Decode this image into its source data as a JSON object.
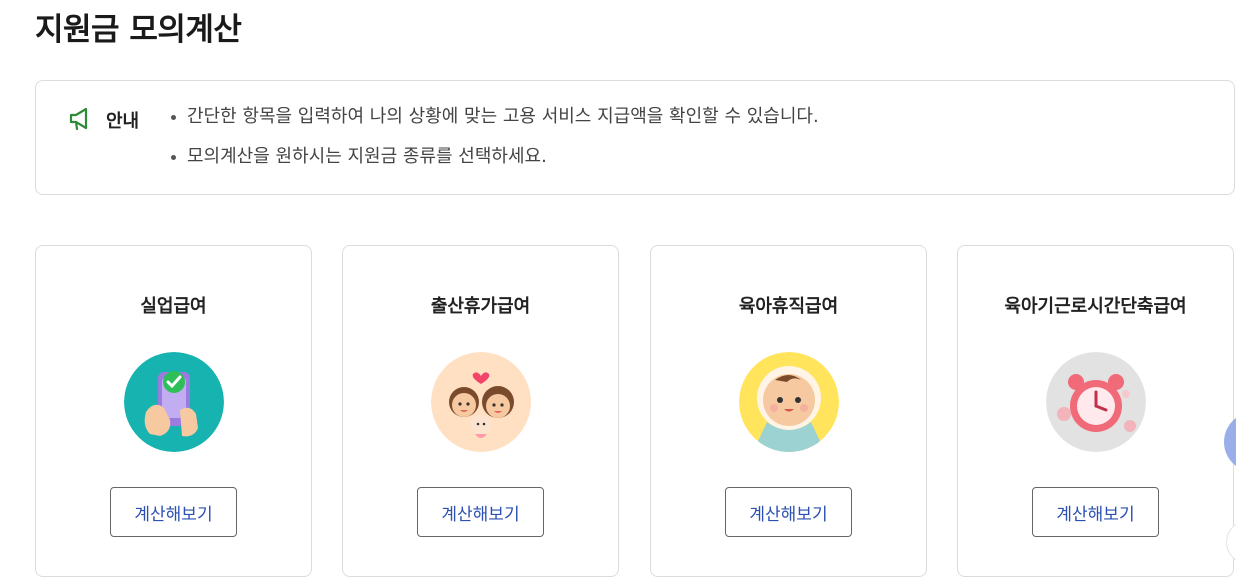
{
  "page": {
    "title": "지원금 모의계산"
  },
  "notice": {
    "label": "안내",
    "icon": "megaphone-icon",
    "icon_color": "#2e8b3a",
    "items": [
      "간단한 항목을 입력하여 나의 상황에 맞는 고용 서비스 지급액을 확인할 수 있습니다.",
      "모의계산을 원하시는 지원금 종류를 선택하세요."
    ]
  },
  "cards": [
    {
      "title": "실업급여",
      "button": "계산해보기",
      "illustration": "phone-check-illustration",
      "bg_color": "#17b3b0"
    },
    {
      "title": "출산휴가급여",
      "button": "계산해보기",
      "illustration": "family-baby-illustration",
      "bg_color": "#ffe0c2"
    },
    {
      "title": "육아휴직급여",
      "button": "계산해보기",
      "illustration": "baby-face-illustration",
      "bg_color": "#ffe45c"
    },
    {
      "title": "육아기근로시간단축급여",
      "button": "계산해보기",
      "illustration": "alarm-clock-illustration",
      "bg_color": "#e2e2e2"
    }
  ],
  "colors": {
    "button_text": "#2b4fb3",
    "border": "#dcdcdc"
  }
}
